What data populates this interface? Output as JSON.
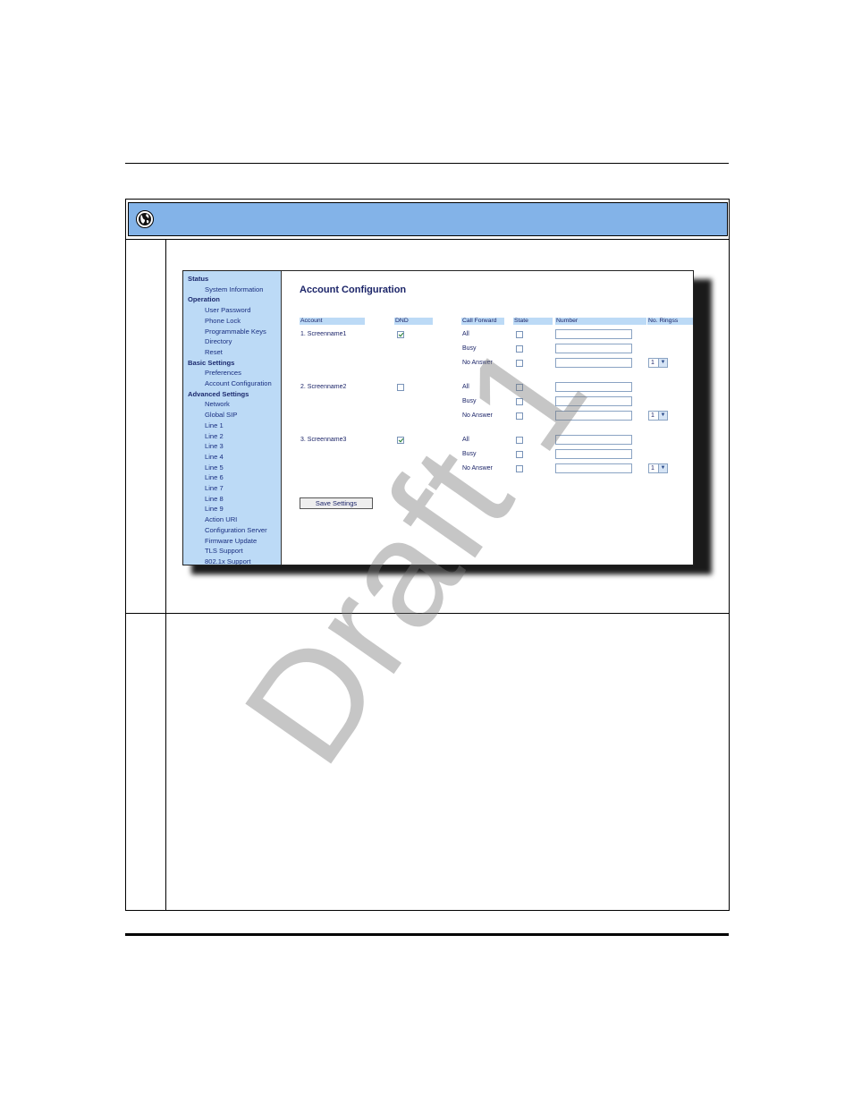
{
  "watermark": "Draft 1",
  "nav": {
    "sections": [
      {
        "label": "Status",
        "items": [
          "System Information"
        ]
      },
      {
        "label": "Operation",
        "items": [
          "User Password",
          "Phone Lock",
          "Programmable Keys",
          "Directory",
          "Reset"
        ]
      },
      {
        "label": "Basic Settings",
        "items": [
          "Preferences",
          "Account Configuration"
        ]
      },
      {
        "label": "Advanced Settings",
        "items": [
          "Network",
          "Global SIP",
          "Line 1",
          "Line 2",
          "Line 3",
          "Line 4",
          "Line 5",
          "Line 6",
          "Line 7",
          "Line 8",
          "Line 9",
          "Action URI",
          "Configuration Server",
          "Firmware Update",
          "TLS Support",
          "802.1x Support"
        ]
      }
    ]
  },
  "page": {
    "title": "Account Configuration",
    "columns": {
      "account": "Account",
      "dnd": "DND",
      "call_forward": "Call Forward",
      "state": "State",
      "number": "Number",
      "no_rings": "No. Ringss"
    },
    "forward_labels": [
      "All",
      "Busy",
      "No Answer"
    ],
    "accounts": [
      {
        "name": "1. Screenname1",
        "dnd": true,
        "states": [
          false,
          false,
          false
        ],
        "numbers": [
          "",
          "",
          ""
        ],
        "rings": "1"
      },
      {
        "name": "2. Screenname2",
        "dnd": false,
        "states": [
          false,
          false,
          false
        ],
        "numbers": [
          "",
          "",
          ""
        ],
        "rings": "1"
      },
      {
        "name": "3. Screenname3",
        "dnd": true,
        "states": [
          false,
          false,
          false
        ],
        "numbers": [
          "",
          "",
          ""
        ],
        "rings": "1"
      }
    ],
    "save_label": "Save Settings"
  }
}
